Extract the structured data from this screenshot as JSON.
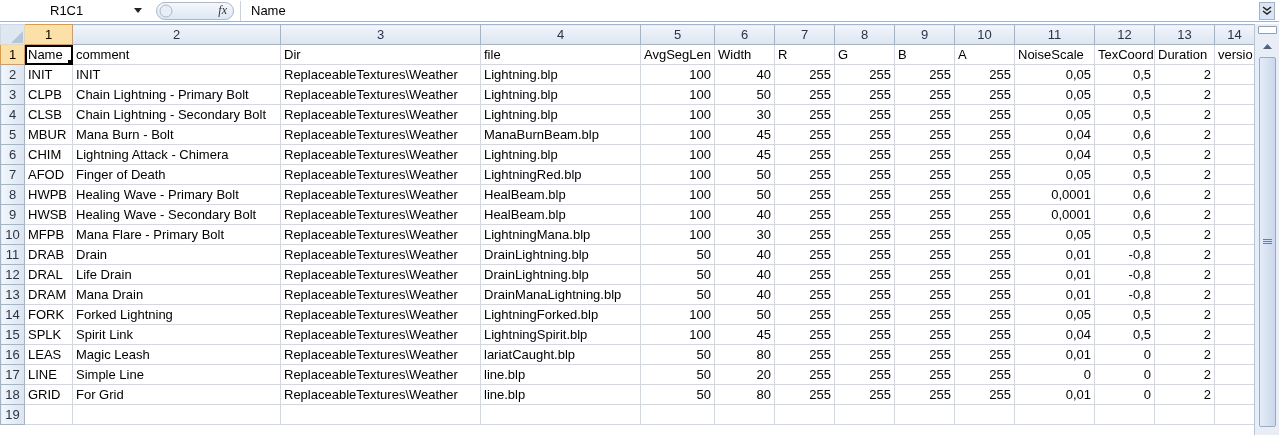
{
  "formula_bar": {
    "name_box": "R1C1",
    "function_label": "fx",
    "value": "Name"
  },
  "columns": [
    {
      "label": "1",
      "kind": "text",
      "selected": true
    },
    {
      "label": "2",
      "kind": "text",
      "selected": false
    },
    {
      "label": "3",
      "kind": "text",
      "selected": false
    },
    {
      "label": "4",
      "kind": "text",
      "selected": false
    },
    {
      "label": "5",
      "kind": "number",
      "selected": false
    },
    {
      "label": "6",
      "kind": "number",
      "selected": false
    },
    {
      "label": "7",
      "kind": "number",
      "selected": false
    },
    {
      "label": "8",
      "kind": "number",
      "selected": false
    },
    {
      "label": "9",
      "kind": "number",
      "selected": false
    },
    {
      "label": "10",
      "kind": "number",
      "selected": false
    },
    {
      "label": "11",
      "kind": "number",
      "selected": false
    },
    {
      "label": "12",
      "kind": "number",
      "selected": false
    },
    {
      "label": "13",
      "kind": "number",
      "selected": false
    },
    {
      "label": "14",
      "kind": "text",
      "selected": false
    }
  ],
  "rows": [
    {
      "number": "1",
      "kind": "header",
      "selected": true,
      "cells": [
        "Name",
        "comment",
        "Dir",
        "file",
        "AvgSegLen",
        "Width",
        "R",
        "G",
        "B",
        "A",
        "NoiseScale",
        "TexCoord",
        "Duration",
        "versio"
      ]
    },
    {
      "number": "2",
      "kind": "data",
      "selected": false,
      "cells": [
        "INIT",
        "INIT",
        "ReplaceableTextures\\Weather",
        "Lightning.blp",
        "100",
        "40",
        "255",
        "255",
        "255",
        "255",
        "0,05",
        "0,5",
        "2"
      ]
    },
    {
      "number": "3",
      "kind": "data",
      "selected": false,
      "cells": [
        "CLPB",
        "Chain Lightning - Primary Bolt",
        "ReplaceableTextures\\Weather",
        "Lightning.blp",
        "100",
        "50",
        "255",
        "255",
        "255",
        "255",
        "0,05",
        "0,5",
        "2"
      ]
    },
    {
      "number": "4",
      "kind": "data",
      "selected": false,
      "cells": [
        "CLSB",
        "Chain Lightning - Secondary Bolt",
        "ReplaceableTextures\\Weather",
        "Lightning.blp",
        "100",
        "30",
        "255",
        "255",
        "255",
        "255",
        "0,05",
        "0,5",
        "2"
      ]
    },
    {
      "number": "5",
      "kind": "data",
      "selected": false,
      "cells": [
        "MBUR",
        "Mana Burn - Bolt",
        "ReplaceableTextures\\Weather",
        "ManaBurnBeam.blp",
        "100",
        "45",
        "255",
        "255",
        "255",
        "255",
        "0,04",
        "0,6",
        "2"
      ]
    },
    {
      "number": "6",
      "kind": "data",
      "selected": false,
      "cells": [
        "CHIM",
        "Lightning Attack - Chimera",
        "ReplaceableTextures\\Weather",
        "Lightning.blp",
        "100",
        "45",
        "255",
        "255",
        "255",
        "255",
        "0,04",
        "0,5",
        "2"
      ]
    },
    {
      "number": "7",
      "kind": "data",
      "selected": false,
      "cells": [
        "AFOD",
        "Finger of Death",
        "ReplaceableTextures\\Weather",
        "LightningRed.blp",
        "100",
        "50",
        "255",
        "255",
        "255",
        "255",
        "0,05",
        "0,5",
        "2"
      ]
    },
    {
      "number": "8",
      "kind": "data",
      "selected": false,
      "cells": [
        "HWPB",
        "Healing Wave - Primary Bolt",
        "ReplaceableTextures\\Weather",
        "HealBeam.blp",
        "100",
        "50",
        "255",
        "255",
        "255",
        "255",
        "0,0001",
        "0,6",
        "2"
      ]
    },
    {
      "number": "9",
      "kind": "data",
      "selected": false,
      "cells": [
        "HWSB",
        "Healing Wave - Secondary Bolt",
        "ReplaceableTextures\\Weather",
        "HealBeam.blp",
        "100",
        "40",
        "255",
        "255",
        "255",
        "255",
        "0,0001",
        "0,6",
        "2"
      ]
    },
    {
      "number": "10",
      "kind": "data",
      "selected": false,
      "cells": [
        "MFPB",
        "Mana Flare - Primary Bolt",
        "ReplaceableTextures\\Weather",
        "LightningMana.blp",
        "100",
        "30",
        "255",
        "255",
        "255",
        "255",
        "0,05",
        "0,5",
        "2"
      ]
    },
    {
      "number": "11",
      "kind": "data",
      "selected": false,
      "cells": [
        "DRAB",
        "Drain",
        "ReplaceableTextures\\Weather",
        "DrainLightning.blp",
        "50",
        "40",
        "255",
        "255",
        "255",
        "255",
        "0,01",
        "-0,8",
        "2"
      ]
    },
    {
      "number": "12",
      "kind": "data",
      "selected": false,
      "cells": [
        "DRAL",
        "Life Drain",
        "ReplaceableTextures\\Weather",
        "DrainLightning.blp",
        "50",
        "40",
        "255",
        "255",
        "255",
        "255",
        "0,01",
        "-0,8",
        "2"
      ]
    },
    {
      "number": "13",
      "kind": "data",
      "selected": false,
      "cells": [
        "DRAM",
        "Mana Drain",
        "ReplaceableTextures\\Weather",
        "DrainManaLightning.blp",
        "50",
        "40",
        "255",
        "255",
        "255",
        "255",
        "0,01",
        "-0,8",
        "2"
      ]
    },
    {
      "number": "14",
      "kind": "data",
      "selected": false,
      "cells": [
        "FORK",
        "Forked Lightning",
        "ReplaceableTextures\\Weather",
        "LightningForked.blp",
        "100",
        "50",
        "255",
        "255",
        "255",
        "255",
        "0,05",
        "0,5",
        "2"
      ]
    },
    {
      "number": "15",
      "kind": "data",
      "selected": false,
      "cells": [
        "SPLK",
        "Spirit Link",
        "ReplaceableTextures\\Weather",
        "LightningSpirit.blp",
        "100",
        "45",
        "255",
        "255",
        "255",
        "255",
        "0,04",
        "0,5",
        "2"
      ]
    },
    {
      "number": "16",
      "kind": "data",
      "selected": false,
      "cells": [
        "LEAS",
        "Magic Leash",
        "ReplaceableTextures\\Weather",
        "lariatCaught.blp",
        "50",
        "80",
        "255",
        "255",
        "255",
        "255",
        "0,01",
        "0",
        "2"
      ]
    },
    {
      "number": "17",
      "kind": "data",
      "selected": false,
      "cells": [
        "LINE",
        "Simple Line",
        "ReplaceableTextures\\Weather",
        "line.blp",
        "50",
        "20",
        "255",
        "255",
        "255",
        "255",
        "0",
        "0",
        "2"
      ]
    },
    {
      "number": "18",
      "kind": "data",
      "selected": false,
      "cells": [
        "GRID",
        "For Grid",
        "ReplaceableTextures\\Weather",
        "line.blp",
        "50",
        "80",
        "255",
        "255",
        "255",
        "255",
        "0,01",
        "0",
        "2"
      ]
    },
    {
      "number": "19",
      "kind": "data",
      "selected": false,
      "cells": []
    }
  ]
}
